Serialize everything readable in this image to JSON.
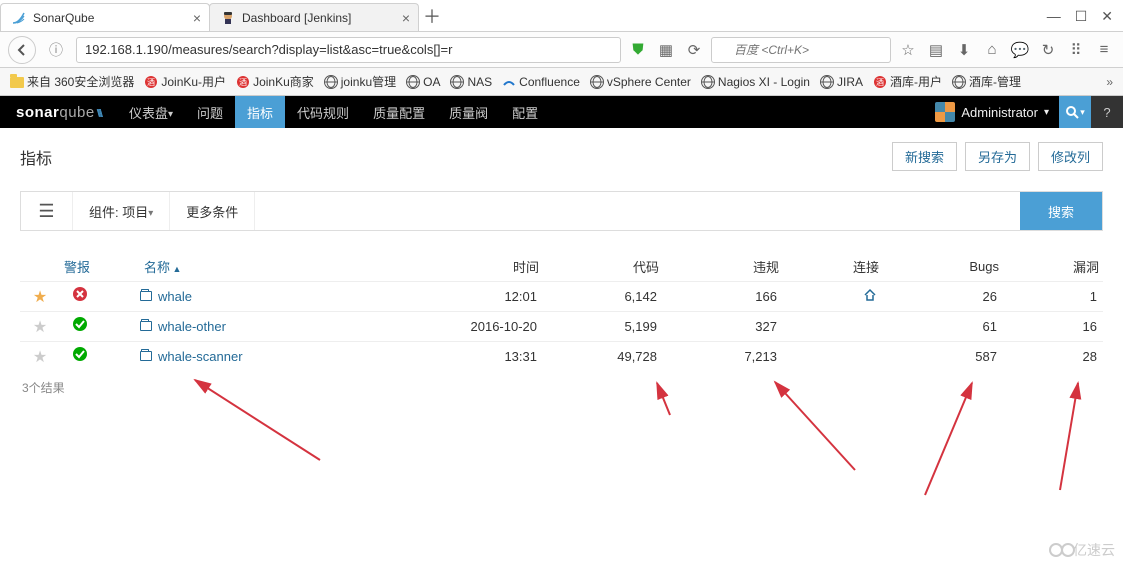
{
  "browser": {
    "tabs": [
      {
        "title": "SonarQube"
      },
      {
        "title": "Dashboard [Jenkins]"
      }
    ],
    "url": "192.168.1.190/measures/search?display=list&asc=true&cols[]=r",
    "search_placeholder": "百度 <Ctrl+K>"
  },
  "bookmarks": [
    {
      "label": "来自 360安全浏览器",
      "icon": "folder"
    },
    {
      "label": "JoinKu-用户",
      "icon": "jk"
    },
    {
      "label": "JoinKu商家",
      "icon": "jk"
    },
    {
      "label": "joinku管理",
      "icon": "globe"
    },
    {
      "label": "OA",
      "icon": "globe"
    },
    {
      "label": "NAS",
      "icon": "globe"
    },
    {
      "label": "Confluence",
      "icon": "conf"
    },
    {
      "label": "vSphere Center",
      "icon": "globe"
    },
    {
      "label": "Nagios XI - Login",
      "icon": "globe"
    },
    {
      "label": "JIRA",
      "icon": "globe"
    },
    {
      "label": "酒库-用户",
      "icon": "jk"
    },
    {
      "label": "酒库-管理",
      "icon": "globe"
    }
  ],
  "sq_nav": {
    "items": [
      {
        "label": "仪表盘",
        "caret": true
      },
      {
        "label": "问题"
      },
      {
        "label": "指标",
        "active": true
      },
      {
        "label": "代码规则"
      },
      {
        "label": "质量配置"
      },
      {
        "label": "质量阀"
      },
      {
        "label": "配置"
      }
    ],
    "user": "Administrator"
  },
  "page": {
    "title": "指标",
    "actions": [
      "新搜索",
      "另存为",
      "修改列"
    ],
    "filter_component": "组件: 项目",
    "filter_more": "更多条件",
    "search_btn": "搜索",
    "result_count": "3个结果"
  },
  "table": {
    "headers": {
      "alert": "警报",
      "name": "名称",
      "time": "时间",
      "code": "代码",
      "violations": "违规",
      "links": "连接",
      "bugs": "Bugs",
      "vulns": "漏洞"
    },
    "rows": [
      {
        "fav": true,
        "status": "fail",
        "name": "whale",
        "time": "12:01",
        "code": "6,142",
        "violations": "166",
        "link": "home",
        "bugs": "26",
        "vulns": "1"
      },
      {
        "fav": false,
        "status": "pass",
        "name": "whale-other",
        "time": "2016-10-20",
        "code": "5,199",
        "violations": "327",
        "link": "",
        "bugs": "61",
        "vulns": "16"
      },
      {
        "fav": false,
        "status": "pass",
        "name": "whale-scanner",
        "time": "13:31",
        "code": "49,728",
        "violations": "7,213",
        "link": "",
        "bugs": "587",
        "vulns": "28"
      }
    ]
  },
  "watermark": "亿速云"
}
